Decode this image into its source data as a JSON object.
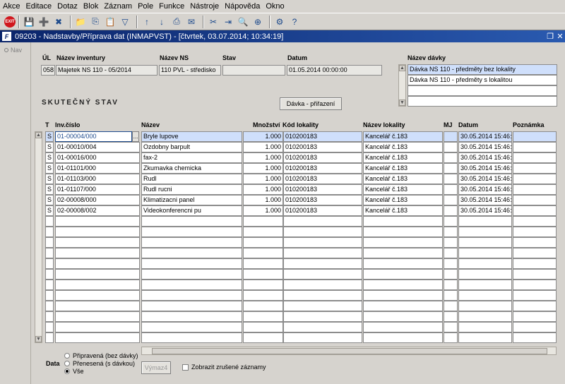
{
  "menu": [
    "Akce",
    "Editace",
    "Dotaz",
    "Blok",
    "Záznam",
    "Pole",
    "Funkce",
    "Nástroje",
    "Nápověda",
    "Okno"
  ],
  "toolbar": {
    "stop_label": "EXIT",
    "icons": [
      "save-icon",
      "new-record-icon",
      "delete-record-icon",
      "folder-icon",
      "copy-icon",
      "paste-icon",
      "filter-icon",
      "sort-icon",
      "sort-desc-icon",
      "print-icon",
      "mail-icon",
      "cut-icon",
      "insert-icon",
      "search-icon",
      "zoom-icon",
      "settings-icon",
      "help-icon"
    ]
  },
  "window": {
    "title": "09203 - Nadstavby/Příprava dat (INMAPVST) - [čtvrtek, 03.07.2014; 10:34:19]",
    "icon_label": "F",
    "controls": [
      "restore-icon",
      "close-icon"
    ]
  },
  "nav": {
    "label": "Nav"
  },
  "header": {
    "labels": {
      "ul": "ÚL",
      "inventory": "Název inventury",
      "ns": "Název NS",
      "stav": "Stav",
      "datum": "Datum",
      "batch": "Název dávky"
    },
    "values": {
      "ul": "058",
      "inventory": "Majetek NS 110 - 05/2014",
      "ns": "110 PVL - středisko",
      "stav": "",
      "datum": "01.05.2014 00:00:00"
    },
    "batches": [
      "Dávka NS 110 - předměty bez lokality",
      "Dávka NS 110 - předměty s lokalitou",
      "",
      ""
    ]
  },
  "section": {
    "title": "SKUTEČNÝ STAV",
    "assign_button": "Dávka - přiřazení"
  },
  "grid": {
    "columns": [
      "T",
      "Inv.číslo",
      "Název",
      "Množství",
      "Kód lokality",
      "Název lokality",
      "MJ",
      "Datum",
      "Poznámka"
    ],
    "rows": [
      {
        "t": "S",
        "inv": "01-00004/000",
        "name": "Bryle lupove",
        "qty": "1.000",
        "code": "010200183",
        "loc": "Kancelář č.183",
        "mj": "",
        "date": "30.05.2014 15:46:1",
        "note": ""
      },
      {
        "t": "S",
        "inv": "01-00010/004",
        "name": "Ozdobny barpult",
        "qty": "1.000",
        "code": "010200183",
        "loc": "Kancelář č.183",
        "mj": "",
        "date": "30.05.2014 15:46:1",
        "note": ""
      },
      {
        "t": "S",
        "inv": "01-00016/000",
        "name": "fax-2",
        "qty": "1.000",
        "code": "010200183",
        "loc": "Kancelář č.183",
        "mj": "",
        "date": "30.05.2014 15:46:1",
        "note": ""
      },
      {
        "t": "S",
        "inv": "01-01101/000",
        "name": "Zkumavka chemicka",
        "qty": "1.000",
        "code": "010200183",
        "loc": "Kancelář č.183",
        "mj": "",
        "date": "30.05.2014 15:46:1",
        "note": ""
      },
      {
        "t": "S",
        "inv": "01-01103/000",
        "name": "Rudl",
        "qty": "1.000",
        "code": "010200183",
        "loc": "Kancelář č.183",
        "mj": "",
        "date": "30.05.2014 15:46:1",
        "note": ""
      },
      {
        "t": "S",
        "inv": "01-01107/000",
        "name": "Rudl rucni",
        "qty": "1.000",
        "code": "010200183",
        "loc": "Kancelář č.183",
        "mj": "",
        "date": "30.05.2014 15:46:1",
        "note": ""
      },
      {
        "t": "S",
        "inv": "02-00008/000",
        "name": "Klimatizacni panel",
        "qty": "1.000",
        "code": "010200183",
        "loc": "Kancelář č.183",
        "mj": "",
        "date": "30.05.2014 15:46:1",
        "note": ""
      },
      {
        "t": "S",
        "inv": "02-00008/002",
        "name": "Videokonferencni pu",
        "qty": "1.000",
        "code": "010200183",
        "loc": "Kancelář č.183",
        "mj": "",
        "date": "30.05.2014 15:46:1",
        "note": ""
      }
    ],
    "total_rows": 20,
    "dots_label": "..."
  },
  "filter": {
    "label": "Data",
    "options": [
      "Připravená (bez dávky)",
      "Přenesená (s dávkou)",
      "Vše"
    ],
    "selected": 2,
    "delete_button": "Výmaz4",
    "show_deleted": "Zobrazit zrušené záznamy"
  }
}
